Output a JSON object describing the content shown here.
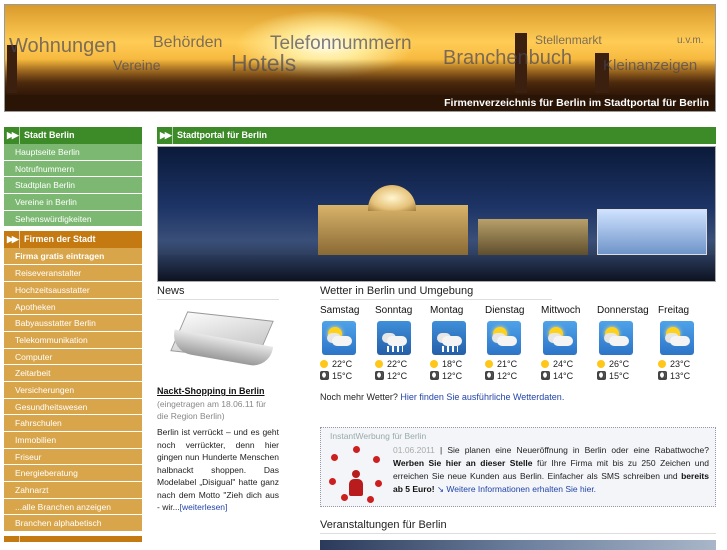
{
  "header": {
    "words": [
      "Wohnungen",
      "Vereine",
      "Behörden",
      "Hotels",
      "Telefonnummern",
      "Branchenbuch",
      "Stellenmarkt",
      "u.v.m.",
      "Kleinanzeigen"
    ],
    "tagline": "Firmenverzeichnis für Berlin im Stadtportal für Berlin"
  },
  "sidebar": {
    "section1": {
      "title": "Stadt Berlin",
      "items": [
        "Hauptseite Berlin",
        "Notrufnummern",
        "Stadtplan Berlin",
        "Vereine in Berlin",
        "Sehenswürdigkeiten"
      ]
    },
    "section2": {
      "title": "Firmen der Stadt",
      "items": [
        "Firma gratis eintragen",
        "Reiseveranstalter",
        "Hochzeitsausstatter",
        "Apotheken",
        "Babyausstatter Berlin",
        "Telekommunikation",
        "Computer",
        "Zeitarbeit",
        "Versicherungen",
        "Gesundheitswesen",
        "Fahrschulen",
        "Immobilien",
        "Friseur",
        "Energieberatung",
        "Zahnarzt",
        "...alle Branchen anzeigen",
        "Branchen alphabetisch"
      ]
    }
  },
  "main": {
    "title": "Stadtportal für Berlin"
  },
  "news": {
    "heading": "News",
    "title": "Nackt-Shopping in Berlin",
    "meta": "(eingetragen am 18.06.11 für die Region Berlin)",
    "body": "Berlin ist verrückt – und es geht noch verrückter, denn hier gingen nun Hunderte Menschen halbnackt shoppen. Das Modelabel „Disigual\" hatte ganz nach dem Motto \"Zieh dich aus - wir...",
    "more": "[weiterlesen]"
  },
  "weather": {
    "heading": "Wetter in Berlin und Umgebung",
    "days": [
      {
        "name": "Samstag",
        "icon": "partly-cloudy",
        "high": "22°C",
        "low": "15°C"
      },
      {
        "name": "Sonntag",
        "icon": "rain",
        "high": "22°C",
        "low": "12°C"
      },
      {
        "name": "Montag",
        "icon": "rain",
        "high": "18°C",
        "low": "12°C"
      },
      {
        "name": "Dienstag",
        "icon": "partly-cloudy",
        "high": "21°C",
        "low": "12°C"
      },
      {
        "name": "Mittwoch",
        "icon": "partly-cloudy",
        "high": "24°C",
        "low": "14°C"
      },
      {
        "name": "Donnerstag",
        "icon": "partly-cloudy",
        "high": "26°C",
        "low": "15°C"
      },
      {
        "name": "Freitag",
        "icon": "partly-cloudy",
        "high": "23°C",
        "low": "13°C"
      }
    ],
    "more_text": "Noch mehr Wetter?",
    "more_link": "Hier finden Sie ausführliche Wetterdaten."
  },
  "instant": {
    "label": "InstantWerbung für Berlin",
    "date": "01.06.2011",
    "sep": "|",
    "t1": "Sie planen eine Neueröffnung in Berlin oder eine Rabattwoche?",
    "b1": "Werben Sie hier an dieser Stelle",
    "t2": "für Ihre Firma mit bis zu 250 Zeichen und erreichen Sie neue Kunden aus Berlin. Einfacher als SMS schreiben und",
    "b2": "bereits ab 5 Euro!",
    "link": "↘ Weitere Informationen erhalten Sie hier."
  },
  "events": {
    "heading": "Veranstaltungen für Berlin"
  }
}
